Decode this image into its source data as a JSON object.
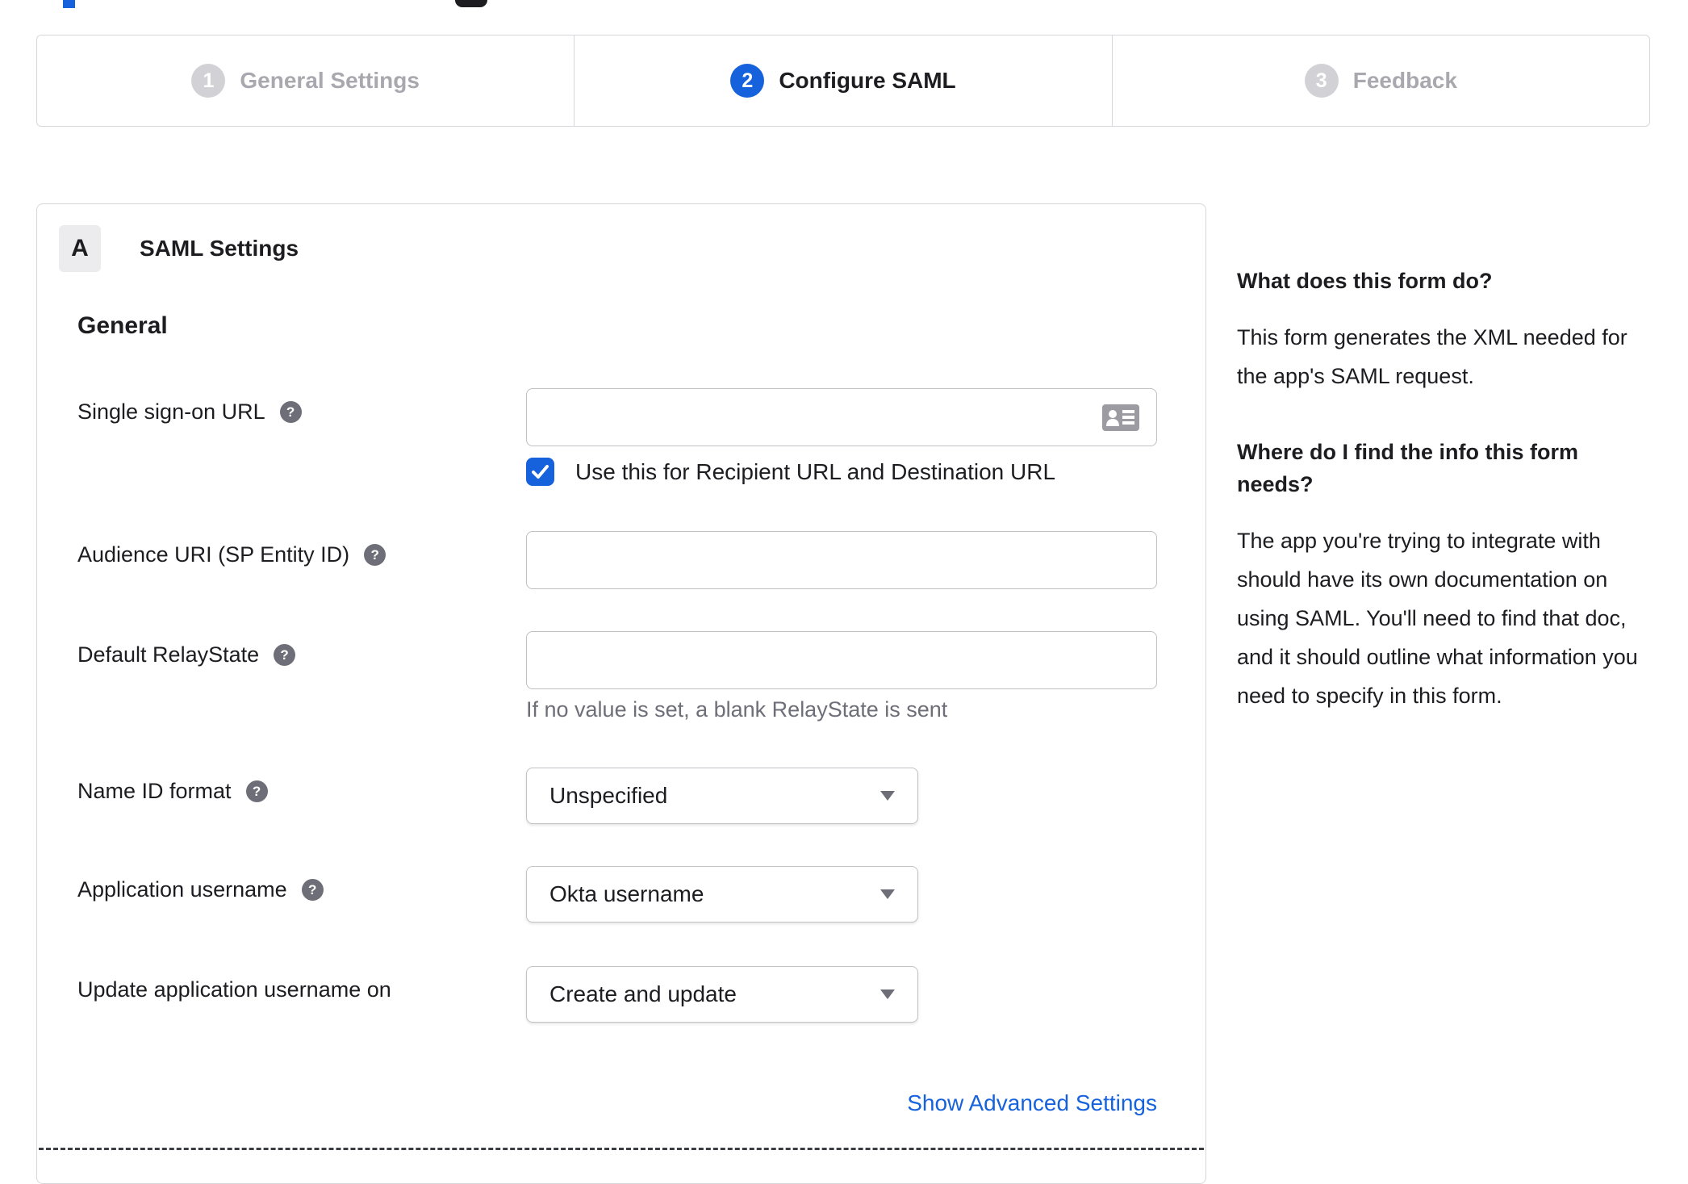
{
  "accent_color": "#1662dd",
  "stepper": {
    "steps": [
      {
        "number": "1",
        "label": "General Settings",
        "state": "inactive"
      },
      {
        "number": "2",
        "label": "Configure SAML",
        "state": "active"
      },
      {
        "number": "3",
        "label": "Feedback",
        "state": "inactive"
      }
    ]
  },
  "panel": {
    "badge": "A",
    "title": "SAML Settings",
    "section": "General",
    "sso": {
      "label": "Single sign-on URL",
      "value": "",
      "checkbox_label": "Use this for Recipient URL and Destination URL",
      "checkbox_checked": true
    },
    "audience": {
      "label": "Audience URI (SP Entity ID)",
      "value": ""
    },
    "relay": {
      "label": "Default RelayState",
      "value": "",
      "helper": "If no value is set, a blank RelayState is sent"
    },
    "nameid": {
      "label": "Name ID format",
      "value": "Unspecified"
    },
    "appuser": {
      "label": "Application username",
      "value": "Okta username"
    },
    "updateuser": {
      "label": "Update application username on",
      "value": "Create and update"
    },
    "advanced_link": "Show Advanced Settings"
  },
  "help": {
    "q1": "What does this form do?",
    "a1": "This form generates the XML needed for the app's SAML request.",
    "q2": "Where do I find the info this form needs?",
    "a2": "The app you're trying to integrate with should have its own documentation on using SAML. You'll need to find that doc, and it should outline what information you need to specify in this form."
  },
  "icons": {
    "help": "question-mark-circle",
    "input_suffix": "contact-card",
    "select_suffix": "chevron-down-triangle",
    "checkbox": "checkmark"
  }
}
